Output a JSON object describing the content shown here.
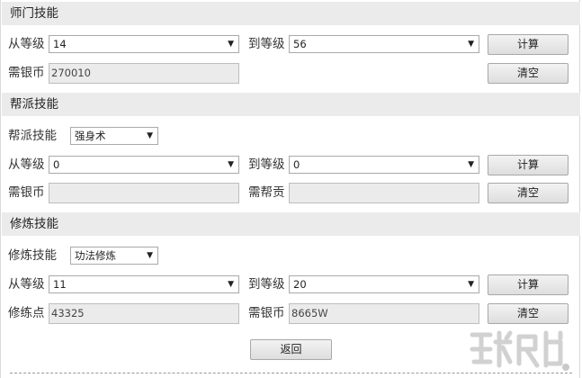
{
  "master_skill": {
    "title": "师门技能",
    "from_level_label": "从等级",
    "from_level_value": "14",
    "to_level_label": "到等级",
    "to_level_value": "56",
    "silver_label": "需银币",
    "silver_value": "270010",
    "calc_button": "计算",
    "clear_button": "清空"
  },
  "gang_skill": {
    "title": "帮派技能",
    "skill_label": "帮派技能",
    "skill_value": "强身术",
    "from_level_label": "从等级",
    "from_level_value": "0",
    "to_level_label": "到等级",
    "to_level_value": "0",
    "silver_label": "需银币",
    "silver_value": "",
    "contribution_label": "需帮贡",
    "contribution_value": "",
    "calc_button": "计算",
    "clear_button": "清空"
  },
  "cultivation_skill": {
    "title": "修炼技能",
    "skill_label": "修炼技能",
    "skill_value": "功法修炼",
    "from_level_label": "从等级",
    "from_level_value": "11",
    "to_level_label": "到等级",
    "to_level_value": "20",
    "points_label": "修练点",
    "points_value": "43325",
    "silver_label": "需银币",
    "silver_value": "8665W",
    "calc_button": "计算",
    "clear_button": "清空"
  },
  "back_button": "返回"
}
